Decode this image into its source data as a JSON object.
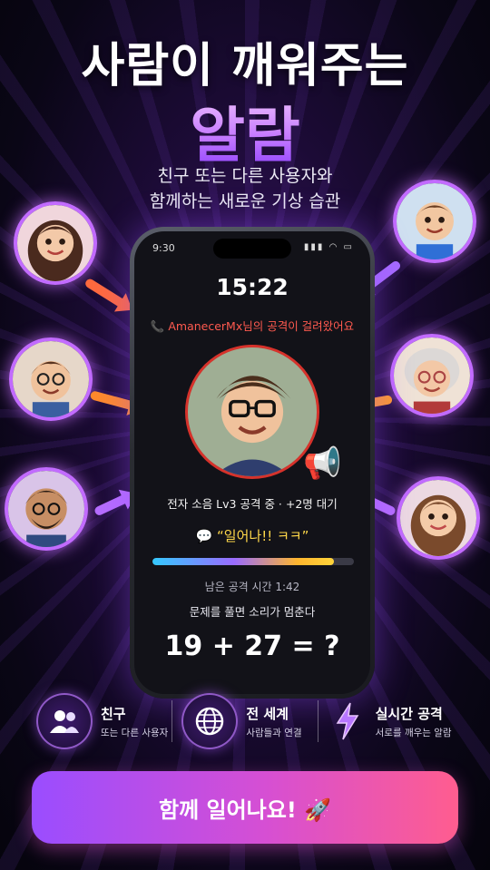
{
  "headline": "사람이 깨워주는",
  "headline_accent": "알람",
  "subtitle_line1": "친구 또는 다른 사용자와",
  "subtitle_line2": "함께하는 새로운 기상 습관",
  "phone": {
    "status_time": "9:30",
    "status_icons": "signal wifi battery",
    "clock": "15:22",
    "alert": "📞 AmanecerMx님의 공격이 걸려왔어요",
    "attack_status": "전자 소음 Lv3 공격 중 · +2명 대기",
    "message": "💬 “일어나!! ㅋㅋ”",
    "progress_fraction": 0.9,
    "remaining": "남은 공격 시간 1:42",
    "hint": "문제를 풀면 소리가 멈춘다",
    "problem": "19 + 27 = ?"
  },
  "features": [
    {
      "title": "친구",
      "sub": "또는 다른 사용자",
      "icon": "people-icon"
    },
    {
      "title": "전 세계",
      "sub": "사람들과 연결",
      "icon": "globe-icon"
    },
    {
      "title": "실시간 공격",
      "sub": "서로를 깨우는 알람",
      "icon": "lightning-icon"
    }
  ],
  "cta_label": "함께 일어나요! 🚀",
  "colors": {
    "accent_purple": "#c26bff",
    "alert_red": "#ff5a4f",
    "message_yellow": "#ffd84a",
    "cta_start": "#9a4dff",
    "cta_end": "#ff5d8f"
  }
}
